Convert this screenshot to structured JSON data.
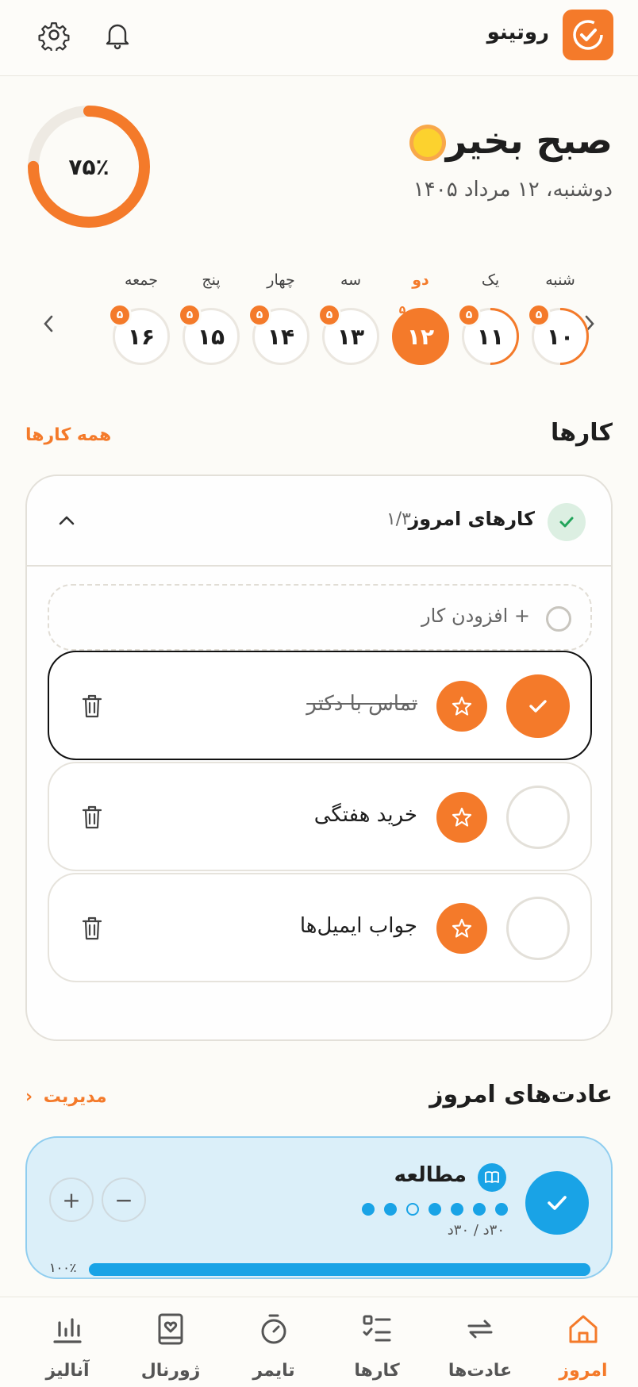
{
  "header": {
    "app_name": "روتینو",
    "icons": [
      "app-logo-icon",
      "bell-icon",
      "gear-icon"
    ]
  },
  "greeting": {
    "title": "صبح بخیر",
    "date": "دوشنبه، ۱۲ مرداد ۱۴۰۵",
    "progress_label": "۷۵٪",
    "progress_value": 0.75
  },
  "days": [
    {
      "name": "شنبه",
      "date": "۱۰",
      "badge": "۵",
      "state": "partial"
    },
    {
      "name": "یک",
      "date": "۱۱",
      "badge": "۵",
      "state": "partial"
    },
    {
      "name": "دو",
      "date": "۱۲",
      "badge": "۵",
      "state": "active"
    },
    {
      "name": "سه",
      "date": "۱۳",
      "badge": "۵",
      "state": "none"
    },
    {
      "name": "چهار",
      "date": "۱۴",
      "badge": "۵",
      "state": "none"
    },
    {
      "name": "پنج",
      "date": "۱۵",
      "badge": "۵",
      "state": "none"
    },
    {
      "name": "جمعه",
      "date": "۱۶",
      "badge": "۵",
      "state": "none"
    }
  ],
  "tasks_section": {
    "title": "کارها",
    "link": "همه کارها"
  },
  "tasks_card": {
    "title": "کارهای امروز",
    "count": "۱/۳",
    "add_label": "+ افزودن کار",
    "items": [
      {
        "label": "تماس با دکتر",
        "done": true
      },
      {
        "label": "خرید هفتگی",
        "done": false
      },
      {
        "label": "جواب ایمیل‌ها",
        "done": false
      }
    ]
  },
  "habits_section": {
    "title": "عادت‌های امروز",
    "link": "مدیریت"
  },
  "habit": {
    "name": "مطالعه",
    "time": "۳۰د / ۳۰د",
    "percent_label": "۱۰۰٪",
    "progress": 1.0,
    "accent": "#19a3e6"
  },
  "bottom_nav": [
    {
      "label": "امروز",
      "icon": "home-icon",
      "active": true
    },
    {
      "label": "عادت‌ها",
      "icon": "repeat-icon",
      "active": false
    },
    {
      "label": "کارها",
      "icon": "checklist-icon",
      "active": false
    },
    {
      "label": "تایمر",
      "icon": "timer-icon",
      "active": false
    },
    {
      "label": "ژورنال",
      "icon": "journal-icon",
      "active": false
    },
    {
      "label": "آنالیز",
      "icon": "chart-icon",
      "active": false
    }
  ],
  "colors": {
    "accent": "#f47a2a",
    "success": "#22a45a",
    "habit": "#19a3e6",
    "background": "#fcfbf7"
  }
}
